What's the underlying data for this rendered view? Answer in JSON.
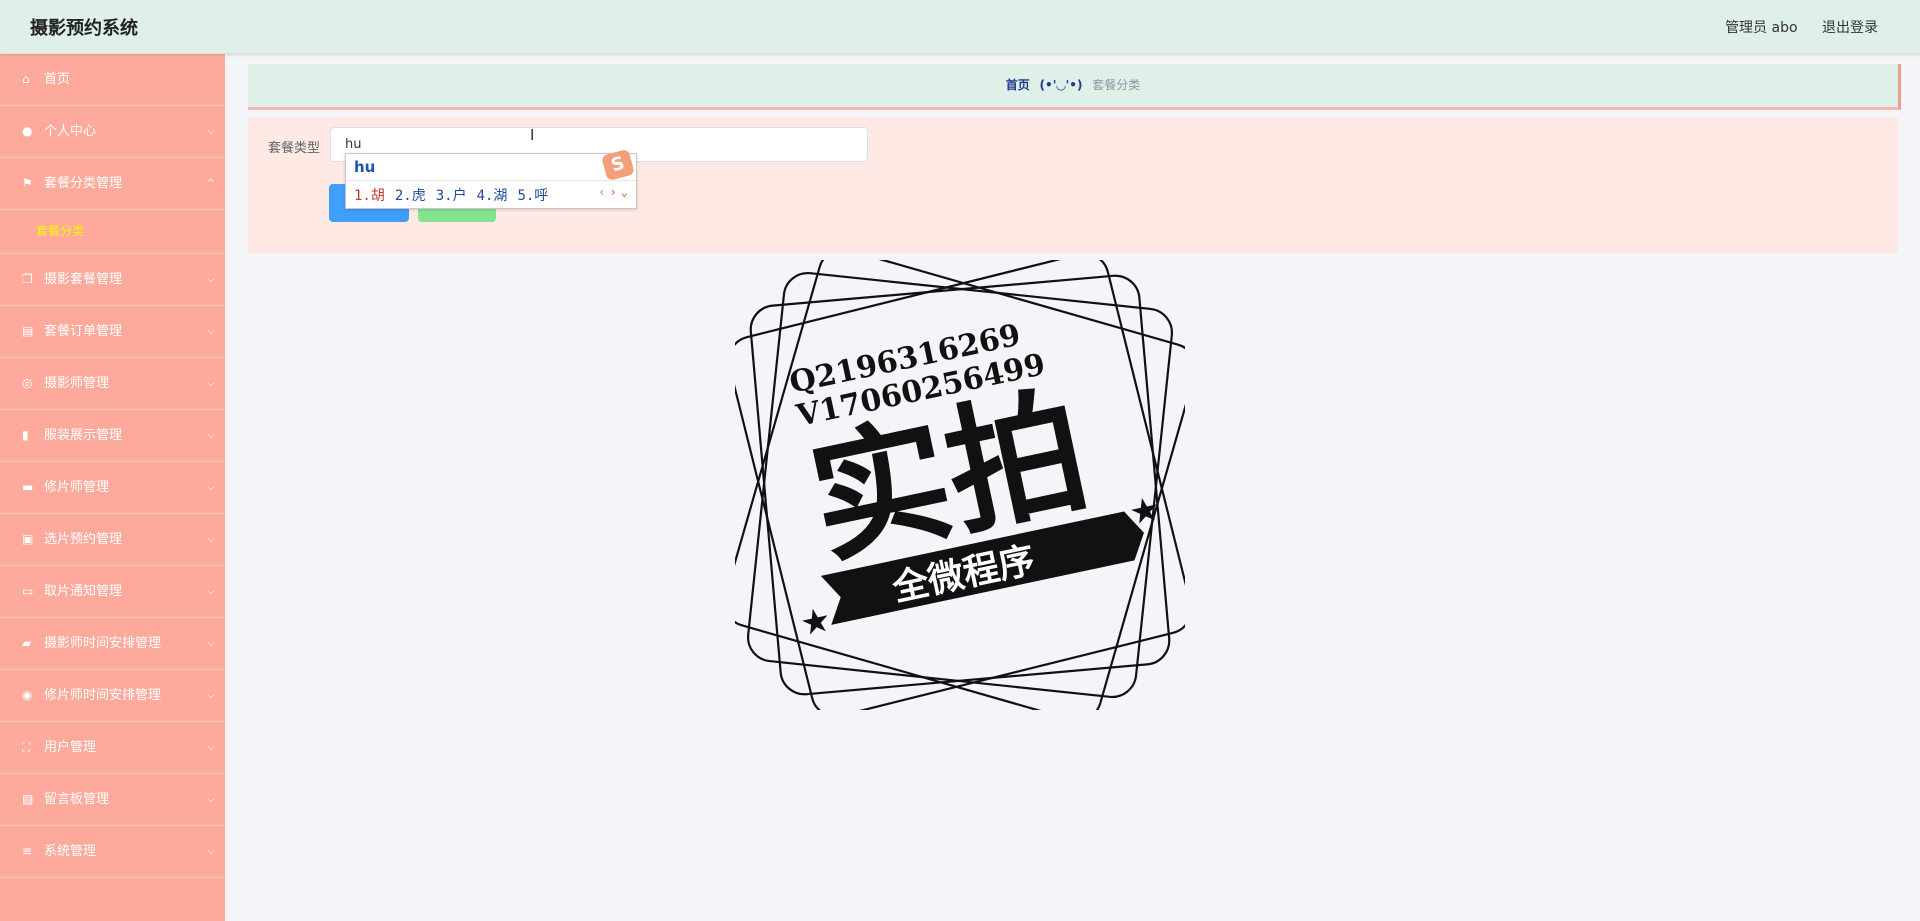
{
  "app": {
    "title": "摄影预约系统"
  },
  "header": {
    "user": "管理员 abo",
    "logout": "退出登录"
  },
  "sidebar": {
    "items": [
      {
        "label": "首页",
        "icon": "home-icon",
        "expandable": false
      },
      {
        "label": "个人中心",
        "icon": "user-icon",
        "expandable": true
      },
      {
        "label": "套餐分类管理",
        "icon": "flag-icon",
        "expandable": true,
        "expanded": true,
        "children": [
          "套餐分类"
        ]
      },
      {
        "label": "摄影套餐管理",
        "icon": "copy-icon",
        "expandable": true
      },
      {
        "label": "套餐订单管理",
        "icon": "clipboard-icon",
        "expandable": true
      },
      {
        "label": "摄影师管理",
        "icon": "compass-icon",
        "expandable": true
      },
      {
        "label": "服装展示管理",
        "icon": "bar-chart-icon",
        "expandable": true
      },
      {
        "label": "修片师管理",
        "icon": "printer-icon",
        "expandable": true
      },
      {
        "label": "选片预约管理",
        "icon": "chart-box-icon",
        "expandable": true
      },
      {
        "label": "取片通知管理",
        "icon": "message-icon",
        "expandable": true
      },
      {
        "label": "摄影师时间安排管理",
        "icon": "chat-icon",
        "expandable": true
      },
      {
        "label": "修片师时间安排管理",
        "icon": "target-icon",
        "expandable": true
      },
      {
        "label": "用户管理",
        "icon": "fullscreen-icon",
        "expandable": true
      },
      {
        "label": "留言板管理",
        "icon": "clipboard-check-icon",
        "expandable": true
      },
      {
        "label": "系统管理",
        "icon": "sliders-icon",
        "expandable": true
      }
    ]
  },
  "breadcrumb": {
    "home": "首页",
    "separator": "(•'◡'•)",
    "current": "套餐分类"
  },
  "search": {
    "label": "套餐类型",
    "value": "hu"
  },
  "ime": {
    "input": "hu",
    "candidates": [
      "1.胡",
      "2.虎",
      "3.户",
      "4.湖",
      "5.呼"
    ],
    "logo": "S"
  },
  "watermark": {
    "line1": "Q2196316269",
    "line2": "V17060256499",
    "main": "实拍",
    "banner": "全微程序"
  },
  "colors": {
    "header_bg": "#dff0e8",
    "sidebar_bg": "#fdaa9c",
    "submenu_active": "#f7f700",
    "query_button": "#409eff",
    "add_button": "#85e38d",
    "search_panel_bg": "#ffe9e5"
  }
}
